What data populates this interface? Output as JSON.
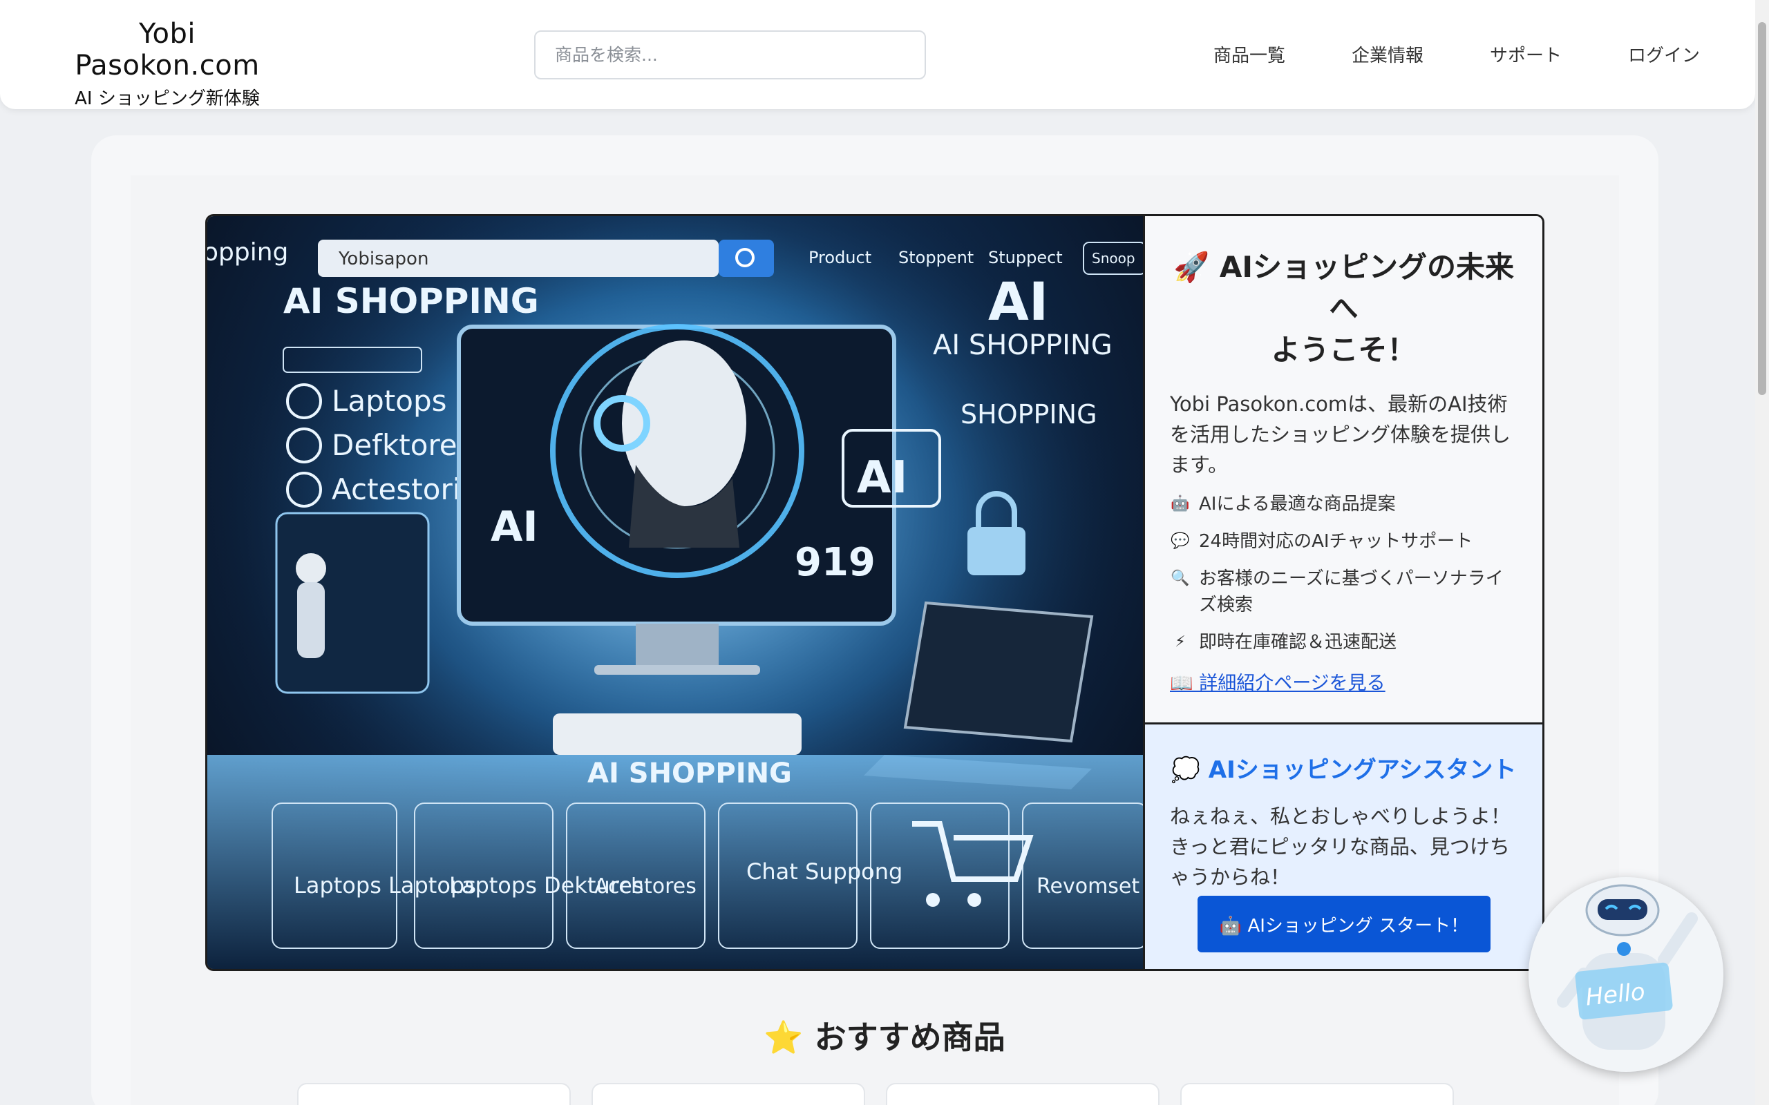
{
  "header": {
    "logo_title": "Yobi Pasokon.com",
    "logo_subtitle": "AI ショッピング新体験",
    "search_placeholder": "商品を検索...",
    "nav": [
      "商品一覧",
      "企業情報",
      "サポート",
      "ログイン"
    ]
  },
  "hero_image": {
    "search_text": "Yobisapon",
    "nav_items": [
      "Product",
      "Stoppent",
      "Stuppect",
      "Snoop"
    ],
    "headline": "AI SHOPPING",
    "categories": [
      "Laptops",
      "Defktores",
      "Actestories"
    ],
    "badges": [
      "AI",
      "AI SHOPPING",
      "SHOPPING",
      "AI",
      "919"
    ],
    "floor_label": "AI SHOPPING",
    "tiles": [
      "Laptops Laptops",
      "Laptops Dektures",
      "Acchtores",
      "Chat Suppong",
      "Revomset"
    ]
  },
  "intro": {
    "title_line1": "🚀 AIショッピングの未来",
    "title_line2": "へ",
    "title_line3": "ようこそ！",
    "description": "Yobi Pasokon.comは、最新のAI技術を活用したショッピング体験を提供します。",
    "features": [
      {
        "icon": "🤖",
        "text": "AIによる最適な商品提案"
      },
      {
        "icon": "💬",
        "text": "24時間対応のAIチャットサポート"
      },
      {
        "icon": "🔍",
        "text": "お客様のニーズに基づくパーソナライズ検索"
      },
      {
        "icon": "⚡",
        "text": "即時在庫確認＆迅速配送"
      }
    ],
    "detail_link": "📖 詳細紹介ページを見る"
  },
  "assistant": {
    "title": "💭 AIショッピングアシスタント",
    "text": "ねぇねぇ、私とおしゃべりしようよ！きっと君にピッタリな商品、見つけちゃうからね！",
    "button": "🤖 AIショッピング スタート！"
  },
  "recommend": {
    "title": "⭐ おすすめ商品"
  },
  "chatbot": {
    "sign": "Hello"
  },
  "colors": {
    "accent_blue": "#0a56d6",
    "assistant_bg": "#e6f0ff",
    "link_blue": "#1a55d8"
  }
}
